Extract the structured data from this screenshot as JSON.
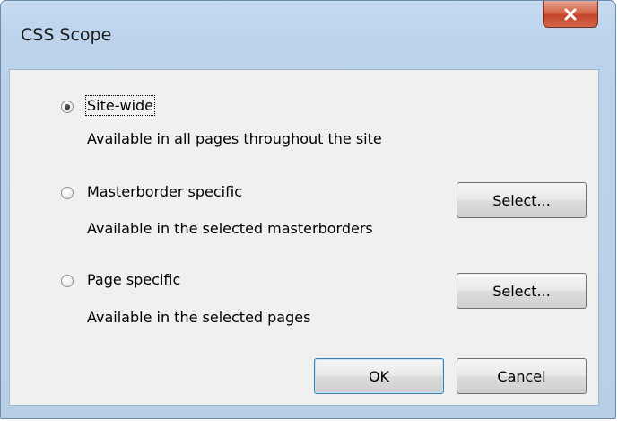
{
  "window": {
    "title": "CSS Scope",
    "close_icon": "close-x-icon"
  },
  "options": [
    {
      "label": "Site-wide",
      "description": "Available in all pages throughout the site",
      "selected": true
    },
    {
      "label": "Masterborder specific",
      "description": "Available in the selected masterborders",
      "selected": false,
      "button_label": "Select..."
    },
    {
      "label": "Page specific",
      "description": "Available in the selected pages",
      "selected": false,
      "button_label": "Select..."
    }
  ],
  "footer": {
    "ok_label": "OK",
    "cancel_label": "Cancel"
  }
}
